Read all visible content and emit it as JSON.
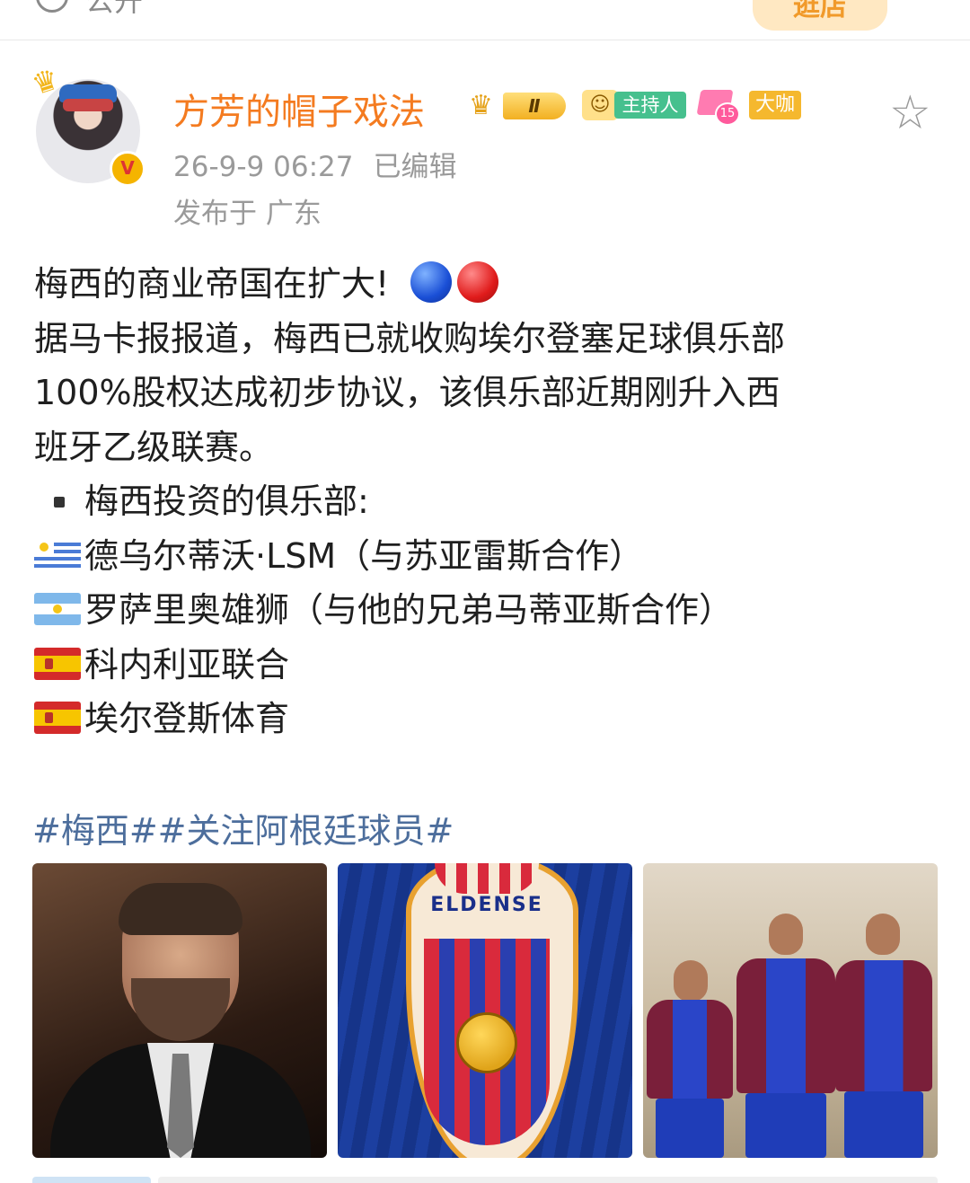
{
  "top": {
    "visibility": "公开",
    "promo": "逛店"
  },
  "author": {
    "name": "方芳的帽子戏法",
    "vip_level": "Ⅱ",
    "host_badge": "主持人",
    "level_badge": "15",
    "daka_badge": "大咖",
    "verified_mark": "V"
  },
  "meta": {
    "time": "26-9-9 06:27",
    "edited": "已编辑",
    "location": "发布于 广东"
  },
  "post": {
    "line1": "梅西的商业帝国在扩大!",
    "line2": "据马卡报报道，梅西已就收购埃尔登塞足球俱乐部",
    "line3": "100%股权达成初步协议，该俱乐部近期刚升入西",
    "line4": "班牙乙级联赛。",
    "list_heading": "梅西投资的俱乐部:",
    "clubs": [
      {
        "flag": "uruguay-flag",
        "text": "德乌尔蒂沃·LSM（与苏亚雷斯合作）"
      },
      {
        "flag": "argentina-flag",
        "text": "罗萨里奥雄狮（与他的兄弟马蒂亚斯合作）"
      },
      {
        "flag": "spain-flag",
        "text": "科内利亚联合"
      },
      {
        "flag": "spain-flag",
        "text": "埃尔登斯体育"
      }
    ],
    "hashtags": "#梅西##关注阿根廷球员#"
  },
  "photos": {
    "crest_text": "ELDENSE"
  },
  "colors": {
    "username": "#f47b20",
    "meta": "#9a9a9a",
    "hashtag": "#4d6e9c",
    "host_badge": "#46c08e",
    "daka_badge": "#f5b82e"
  }
}
